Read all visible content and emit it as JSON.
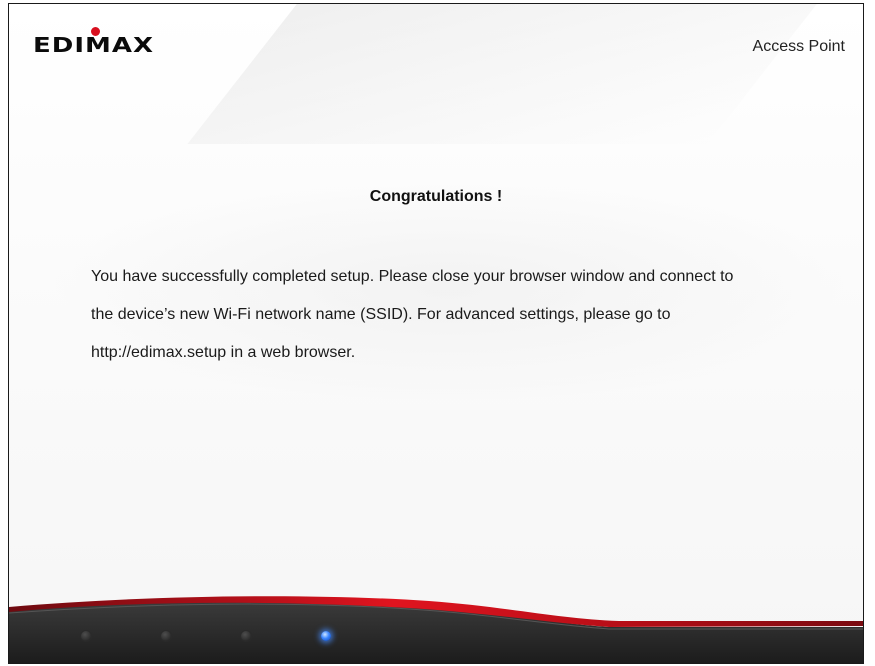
{
  "header": {
    "logo_text": "EDIMAX",
    "mode_label": "Access Point"
  },
  "content": {
    "title": "Congratulations !",
    "message_lines": [
      "You have successfully completed setup. Please close your browser window and connect to",
      "the device’s new Wi-Fi network name (SSID). For advanced settings, please go to",
      "http://edimax.setup in a web browser."
    ]
  },
  "footer": {
    "steps": [
      {
        "state": "inactive"
      },
      {
        "state": "inactive"
      },
      {
        "state": "inactive"
      },
      {
        "state": "active"
      }
    ]
  },
  "colors": {
    "brand_red": "#d80f1e",
    "active_step": "#3b86ff",
    "footer_dark": "#2b2b2b"
  }
}
